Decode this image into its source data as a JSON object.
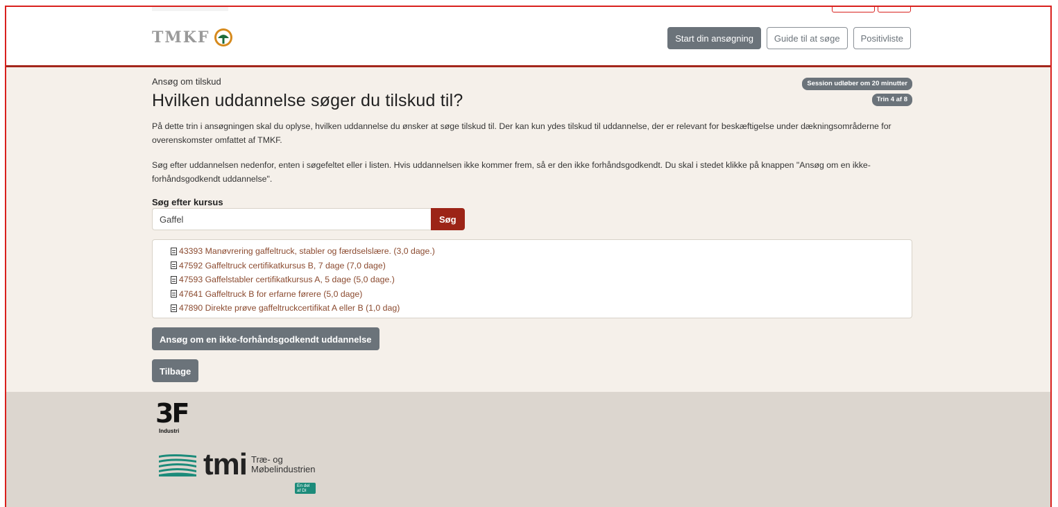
{
  "header": {
    "logo_text": "TMKF",
    "nav": {
      "start": "Start din ansøgning",
      "guide": "Guide til at søge",
      "positive": "Positivliste"
    }
  },
  "main": {
    "breadcrumb": "Ansøg om tilskud",
    "session_badge": "Session udløber om 20 minutter",
    "step_badge": "Trin 4 af 8",
    "title": "Hvilken uddannelse søger du tilskud til?",
    "paragraph1": "På dette trin i ansøgningen skal du oplyse, hvilken uddannelse du ønsker at søge tilskud til. Der kan kun ydes tilskud til uddannelse, der er relevant for beskæftigelse under dækningsområderne for overenskomster omfattet af TMKF.",
    "paragraph2": "Søg efter uddannelsen nedenfor, enten i søgefeltet eller i listen. Hvis uddannelsen ikke kommer frem, så er den ikke forhåndsgodkendt. Du skal i stedet klikke på knappen \"Ansøg om en ikke-forhåndsgodkendt uddannelse\".",
    "search": {
      "label": "Søg efter kursus",
      "value": "Gaffel",
      "button": "Søg"
    },
    "results": [
      "43393 Manøvrering gaffeltruck, stabler og færdselslære. (3,0 dage.)",
      "47592 Gaffeltruck certifikatkursus B, 7 dage (7,0 dage)",
      "47593 Gaffelstabler certifikatkursus A, 5 dage (5,0 dage.)",
      "47641 Gaffeltruck B for erfarne førere (5,0 dage)",
      "47890 Direkte prøve gaffeltruckcertifikat A eller B (1,0 dag)"
    ],
    "apply_button": "Ansøg om en ikke-forhåndsgodkendt uddannelse",
    "back_button": "Tilbage"
  },
  "footer": {
    "logo_3f": "3F",
    "logo_3f_sub": "Industri",
    "logo_tmi": "tmi",
    "logo_tmi_sub1": "Træ- og",
    "logo_tmi_sub2": "Møbelindustrien",
    "logo_tmi_tag": "En del af DI"
  },
  "colors": {
    "accent_red": "#9c2417",
    "border_red": "#d9201d",
    "header_rule": "#a3261b",
    "content_bg": "#f5f0ea",
    "footer_bg": "#dcd6cf",
    "button_gray": "#6b737a",
    "link_brown": "#8b4a2f",
    "tmi_teal": "#1c8b7a"
  },
  "icons": {
    "logo": "tree-circle-icon",
    "result": "document-icon"
  }
}
